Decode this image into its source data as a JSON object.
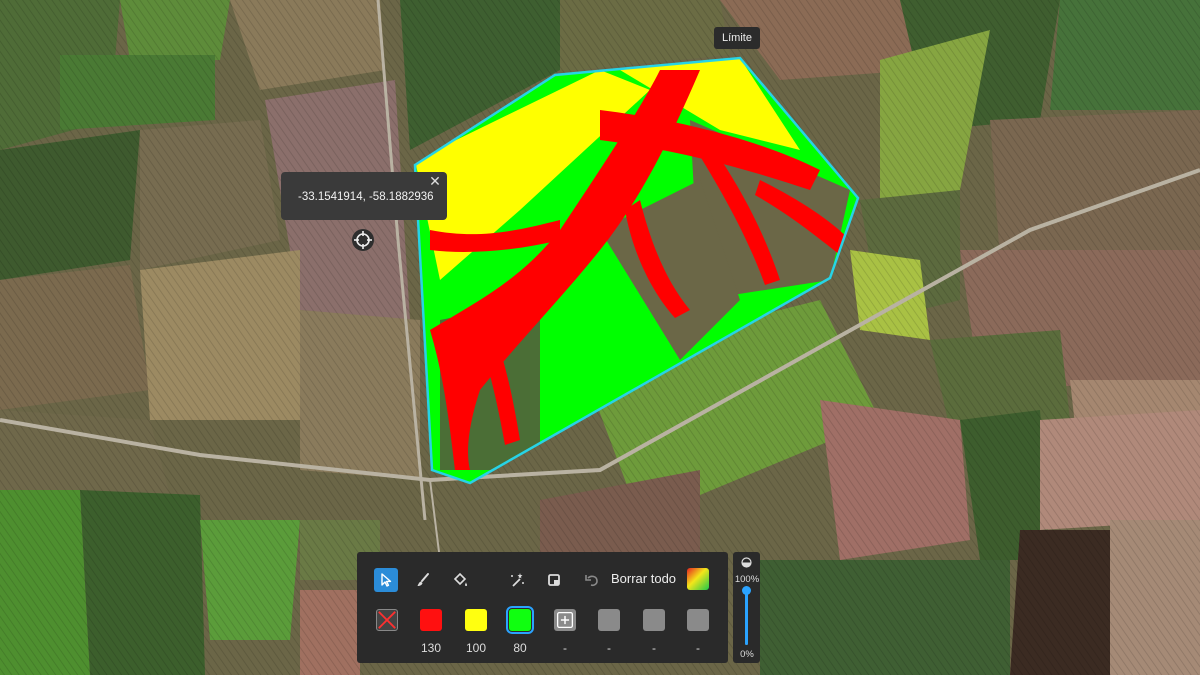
{
  "map": {
    "boundary_tooltip": "Límite",
    "coordinate_popup": {
      "text": "-33.1541914, -58.1882936",
      "close_icon": "close-icon"
    },
    "crosshair_icon": "crosshair-icon",
    "boundary_color": "#27d3e6"
  },
  "toolbar": {
    "tools": [
      {
        "name": "select-tool",
        "icon": "cursor-icon",
        "active": true
      },
      {
        "name": "brush-tool",
        "icon": "brush-icon",
        "active": false
      },
      {
        "name": "fill-tool",
        "icon": "paint-bucket-icon",
        "active": false
      },
      {
        "name": "magic-wand-tool",
        "icon": "magic-wand-icon",
        "active": false
      },
      {
        "name": "crop-tool",
        "icon": "crop-icon",
        "active": false
      },
      {
        "name": "undo-tool",
        "icon": "undo-icon",
        "active": false
      }
    ],
    "clear_all_label": "Borrar todo",
    "gradient_icon": "gradient-icon",
    "swatches": [
      {
        "type": "none",
        "icon": "no-fill-icon",
        "value": ""
      },
      {
        "type": "color",
        "color": "#ff1010",
        "value": "130"
      },
      {
        "type": "color",
        "color": "#ffff10",
        "value": "100"
      },
      {
        "type": "color",
        "color": "#10ff10",
        "value": "80",
        "selected": true
      },
      {
        "type": "add",
        "icon": "add-zone-icon",
        "value": "-"
      },
      {
        "type": "empty",
        "value": "-"
      },
      {
        "type": "empty",
        "value": "-"
      },
      {
        "type": "empty",
        "value": "-"
      }
    ]
  },
  "opacity": {
    "icon": "opacity-icon",
    "max_label": "100%",
    "min_label": "0%",
    "value": 1.0
  },
  "zone_colors": {
    "high": "#ff1010",
    "medium": "#ffff10",
    "low": "#10ff10"
  }
}
